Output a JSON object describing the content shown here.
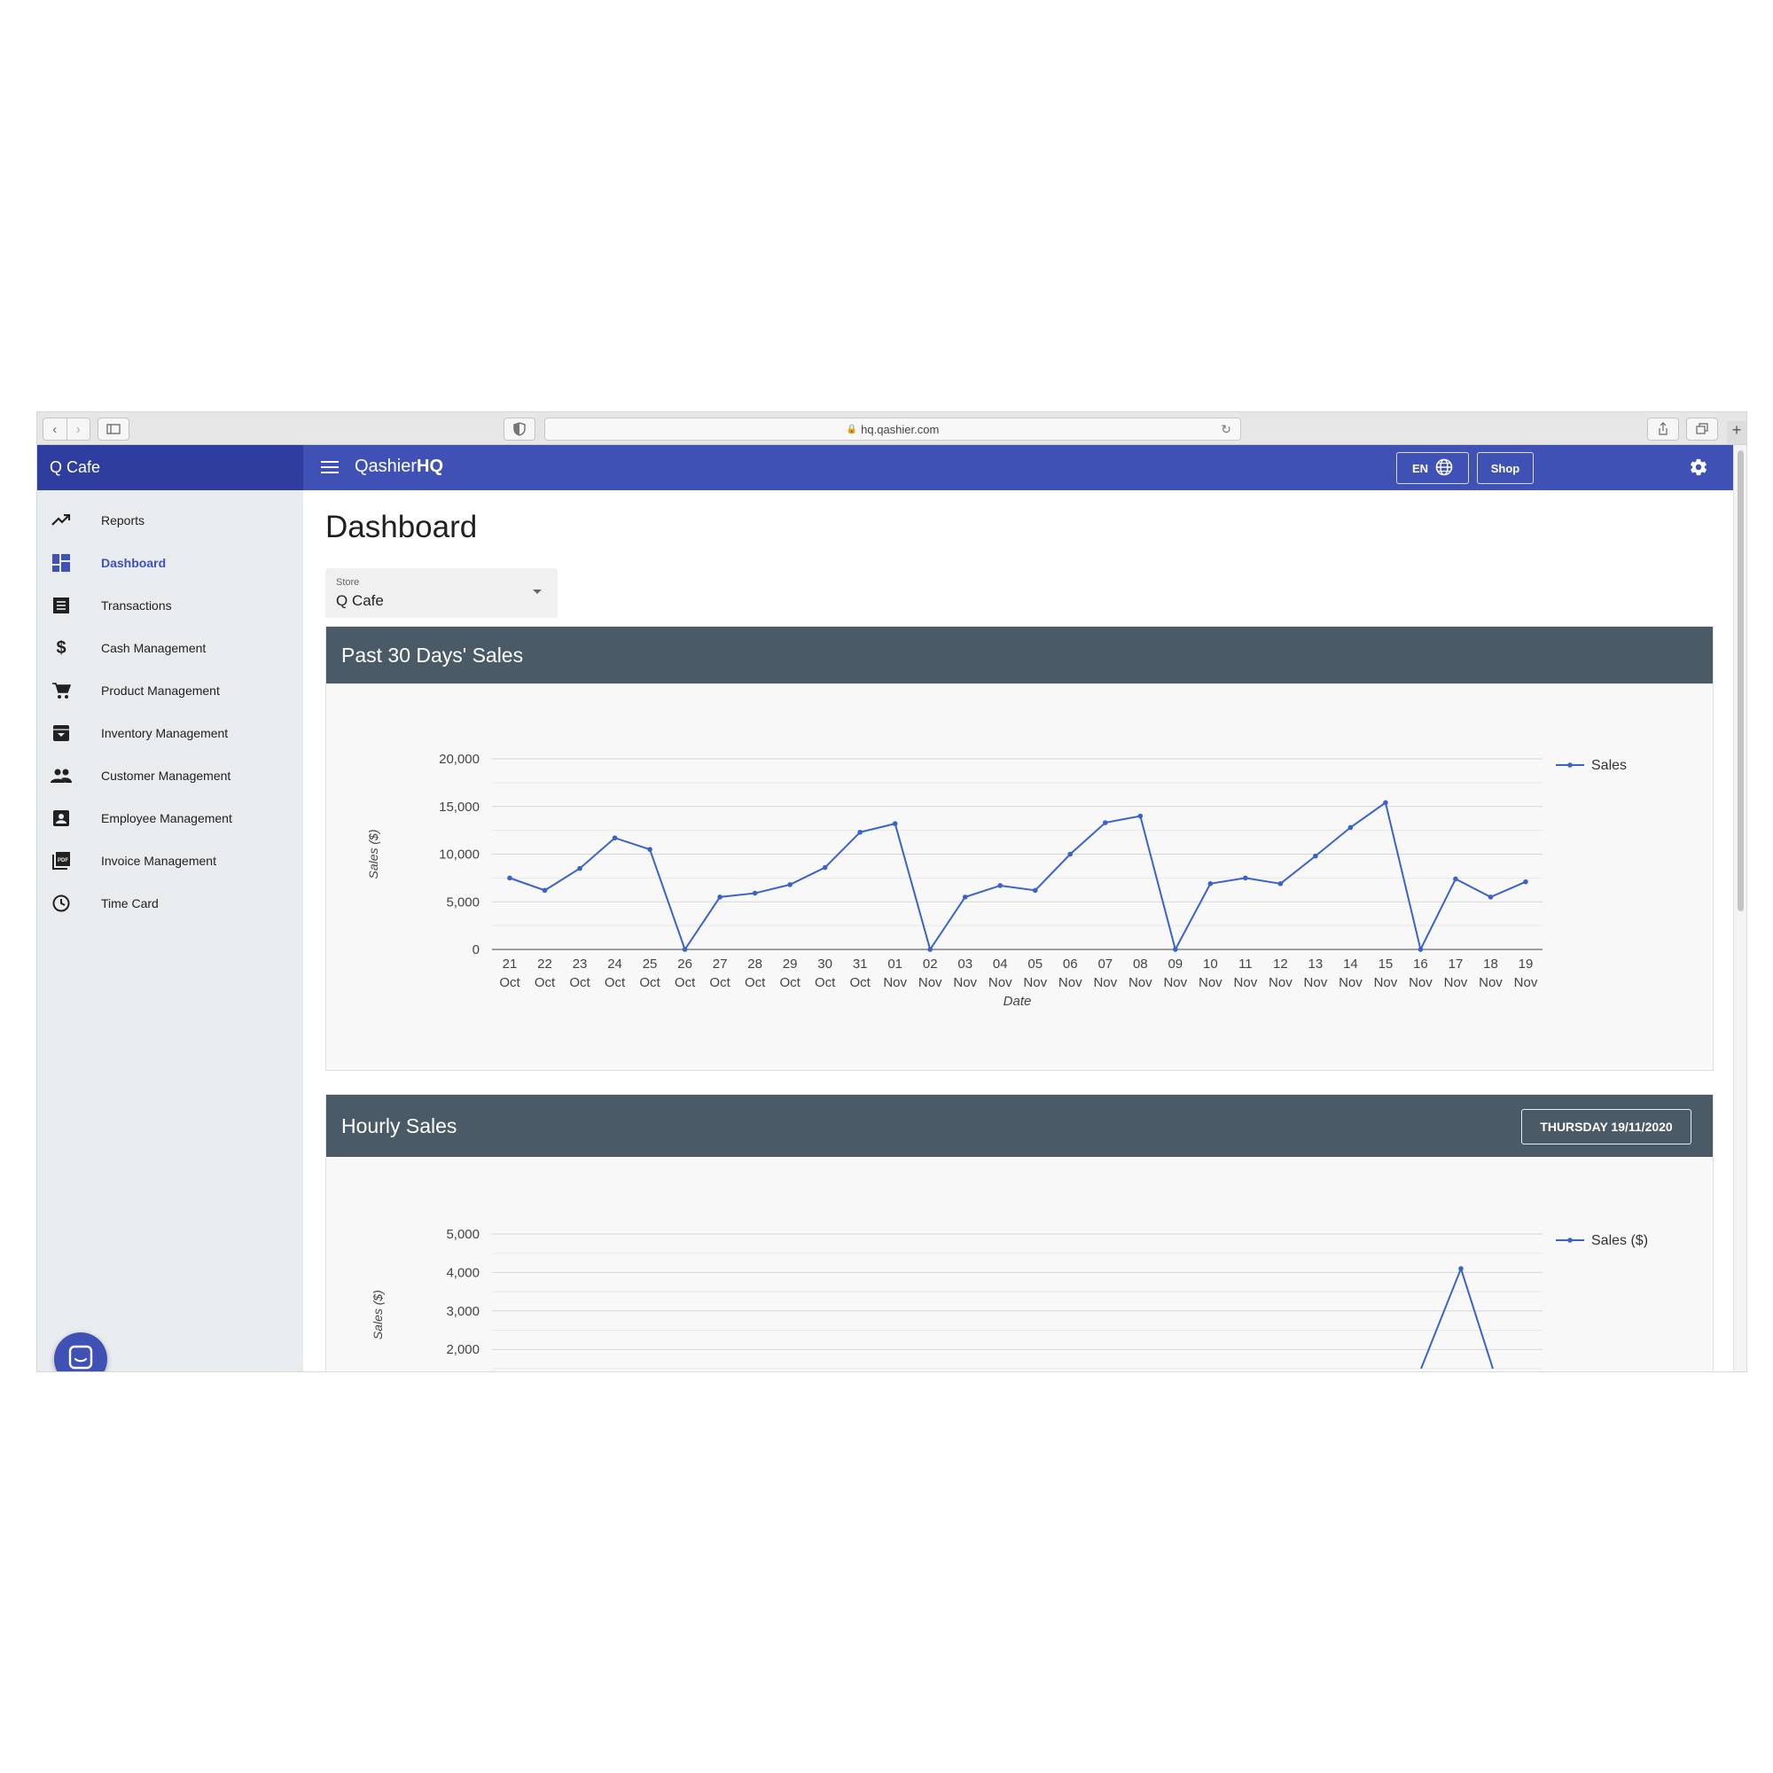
{
  "browser": {
    "url": "hq.qashier.com"
  },
  "sidebar": {
    "store_name": "Q Cafe",
    "items": [
      {
        "label": "Reports",
        "icon": "trending-up-icon"
      },
      {
        "label": "Dashboard",
        "icon": "dashboard-icon",
        "active": true
      },
      {
        "label": "Transactions",
        "icon": "receipt-icon"
      },
      {
        "label": "Cash Management",
        "icon": "dollar-icon"
      },
      {
        "label": "Product Management",
        "icon": "cart-icon"
      },
      {
        "label": "Inventory Management",
        "icon": "archive-icon"
      },
      {
        "label": "Customer Management",
        "icon": "people-icon"
      },
      {
        "label": "Employee Management",
        "icon": "contact-icon"
      },
      {
        "label": "Invoice Management",
        "icon": "pdf-icon"
      },
      {
        "label": "Time Card",
        "icon": "clock-icon"
      }
    ]
  },
  "topbar": {
    "brand_light": "Qashier",
    "brand_bold": "HQ",
    "lang_label": "EN",
    "shop_label": "Shop"
  },
  "page": {
    "title": "Dashboard",
    "store_select": {
      "label": "Store",
      "value": "Q Cafe"
    }
  },
  "colors": {
    "primary": "#3f51b5",
    "sidebar_header": "#2f3e9e",
    "card_header": "#4a5b67",
    "line": "#3a63c7"
  },
  "chart_data": [
    {
      "type": "line",
      "card_title": "Past 30 Days' Sales",
      "xlabel": "Date",
      "ylabel": "Sales ($)",
      "ylim": [
        0,
        20000
      ],
      "yticks": [
        "0",
        "5,000",
        "10,000",
        "15,000",
        "20,000"
      ],
      "x": [
        [
          "21",
          "Oct"
        ],
        [
          "22",
          "Oct"
        ],
        [
          "23",
          "Oct"
        ],
        [
          "24",
          "Oct"
        ],
        [
          "25",
          "Oct"
        ],
        [
          "26",
          "Oct"
        ],
        [
          "27",
          "Oct"
        ],
        [
          "28",
          "Oct"
        ],
        [
          "29",
          "Oct"
        ],
        [
          "30",
          "Oct"
        ],
        [
          "31",
          "Oct"
        ],
        [
          "01",
          "Nov"
        ],
        [
          "02",
          "Nov"
        ],
        [
          "03",
          "Nov"
        ],
        [
          "04",
          "Nov"
        ],
        [
          "05",
          "Nov"
        ],
        [
          "06",
          "Nov"
        ],
        [
          "07",
          "Nov"
        ],
        [
          "08",
          "Nov"
        ],
        [
          "09",
          "Nov"
        ],
        [
          "10",
          "Nov"
        ],
        [
          "11",
          "Nov"
        ],
        [
          "12",
          "Nov"
        ],
        [
          "13",
          "Nov"
        ],
        [
          "14",
          "Nov"
        ],
        [
          "15",
          "Nov"
        ],
        [
          "16",
          "Nov"
        ],
        [
          "17",
          "Nov"
        ],
        [
          "18",
          "Nov"
        ],
        [
          "19",
          "Nov"
        ]
      ],
      "series": [
        {
          "name": "Sales",
          "values": [
            7500,
            6200,
            8500,
            11700,
            10500,
            0,
            5500,
            5900,
            6800,
            8600,
            12300,
            13200,
            0,
            5500,
            6700,
            6200,
            10000,
            13300,
            14000,
            0,
            6900,
            7500,
            6900,
            9800,
            12800,
            15400,
            0,
            7400,
            5500,
            7100
          ]
        }
      ],
      "legend": "right"
    },
    {
      "type": "line",
      "card_title": "Hourly Sales",
      "date_button": "THURSDAY 19/11/2020",
      "ylabel": "Sales ($)",
      "ylim": [
        0,
        5000
      ],
      "yticks": [
        "2,000",
        "3,000",
        "4,000",
        "5,000"
      ],
      "series": [
        {
          "name": "Sales ($)",
          "partial_visible_peak": 4100
        }
      ],
      "legend": "right"
    }
  ]
}
